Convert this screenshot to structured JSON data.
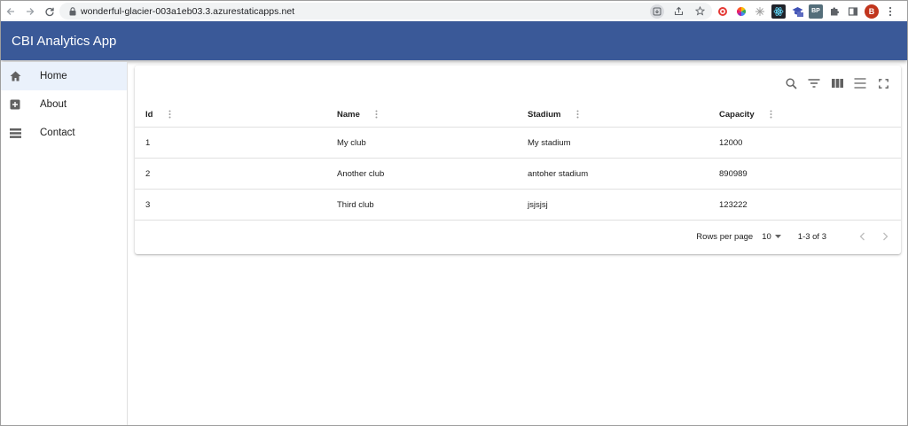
{
  "browser": {
    "url": "wonderful-glacier-003a1eb03.3.azurestaticapps.net",
    "avatar_letter": "B",
    "ext_badge": "BP"
  },
  "app": {
    "title": "CBI Analytics App"
  },
  "sidebar": {
    "items": [
      {
        "label": "Home",
        "icon": "home-icon",
        "active": true
      },
      {
        "label": "About",
        "icon": "add-box-icon",
        "active": false
      },
      {
        "label": "Contact",
        "icon": "list-icon",
        "active": false
      }
    ]
  },
  "grid": {
    "columns": [
      "Id",
      "Name",
      "Stadium",
      "Capacity"
    ],
    "rows": [
      [
        "1",
        "My club",
        "My stadium",
        "12000"
      ],
      [
        "2",
        "Another club",
        "antoher stadium",
        "890989"
      ],
      [
        "3",
        "Third club",
        "jsjsjsj",
        "123222"
      ]
    ],
    "footer": {
      "rows_per_page_label": "Rows per page",
      "rows_per_page_value": "10",
      "range": "1-3 of 3"
    }
  },
  "colors": {
    "appbar": "#3a5998",
    "active_nav": "#eaf1fb",
    "avatar": "#c1351d"
  }
}
